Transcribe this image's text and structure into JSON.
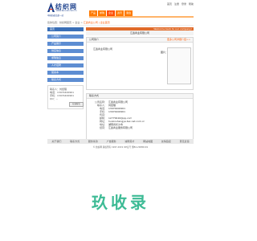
{
  "header": {
    "logo_text": "纺织网",
    "logo_url": "www.tex-net.com.cn",
    "logo_slogan": "中国纺织品第一站",
    "top_links": [
      "首页",
      "注册",
      "登录",
      "帮助"
    ],
    "nav": [
      "产品",
      "求购",
      "企业",
      "资讯",
      "展会"
    ]
  },
  "breadcrumb": {
    "prefix": "您的位置：纺织网首页 > 企业 > ",
    "current": "汇鑫商业公司 | 企业首页"
  },
  "sidebar": {
    "head": "首页",
    "items": [
      "公司简介",
      "产品展示",
      "供应信息",
      "求购信息",
      "人才招聘",
      "留言本",
      "联系方式"
    ]
  },
  "contact": {
    "lines": [
      "联系人：刘经理",
      "电话：13974400961",
      "手机：13974400961",
      "QQ：--"
    ],
    "button_label": "在线留言"
  },
  "main": {
    "welcome": "Welcome back to our company!",
    "company_name": "汇鑫商业有限公司",
    "intro_title": "公司简介",
    "intro_more": "更多公司详细介绍>>",
    "intro_text": "汇鑫商业有限公司",
    "photo_label": "图片：",
    "detail_title": "联系方式",
    "details": [
      {
        "k": "公司名称：",
        "v": "汇鑫商业有限公司"
      },
      {
        "k": "联系人：",
        "v": "刘经理"
      },
      {
        "k": "电话：",
        "v": "13974400961"
      },
      {
        "k": "手机：",
        "v": "13974400961"
      },
      {
        "k": "传真：",
        "v": ""
      },
      {
        "k": "邮箱：",
        "v": "12779916@qq.com"
      },
      {
        "k": "网址：",
        "v": "huixinshangye.tex-net.com.cn"
      },
      {
        "k": "地址：",
        "v": "湖南省长沙市"
      },
      {
        "k": "经营：",
        "v": "汇鑫商业服务有限公司"
      }
    ]
  },
  "footer": {
    "links": [
      "关于我们",
      "联系方式",
      "服务条款",
      "广告服务",
      "诚聘英才",
      "网站地图",
      "友情链接",
      "意见反馈"
    ],
    "copyright": "© 纺织网 版权所有 1997-2019 ICP证号 浙B2-20080101"
  },
  "watermark": {
    "text": "玖收录"
  },
  "colors": {
    "accent_orange": "#ff7a00",
    "sidebar_blue": "#5d8dd2",
    "watermark_green": "#3dbb95"
  }
}
